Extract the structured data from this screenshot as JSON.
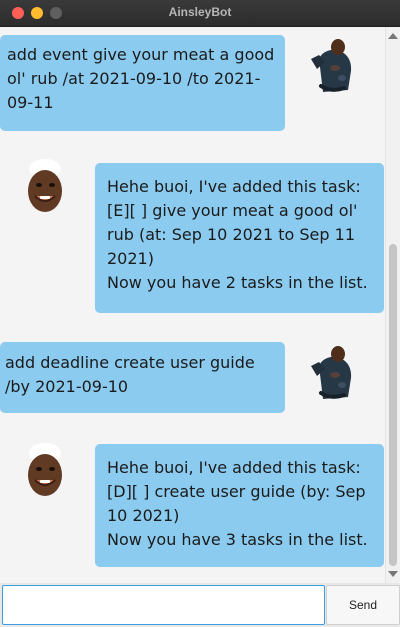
{
  "window": {
    "title": "AinsleyBot"
  },
  "messages": [
    {
      "sender": "user",
      "text": "add event give your meat a good ol' rub /at 2021-09-10 /to 2021-09-11"
    },
    {
      "sender": "bot",
      "lines": [
        "Hehe buoi, I've added this task:",
        "[E][ ] give your meat a good ol' rub (at: Sep 10 2021 to Sep 11 2021)",
        "Now you have 2 tasks in the list."
      ]
    },
    {
      "sender": "user",
      "text": "add deadline create user guide /by 2021-09-10"
    },
    {
      "sender": "bot",
      "lines": [
        "Hehe buoi, I've added this task:",
        "[D][ ] create user guide (by: Sep 10 2021)",
        "Now you have 3 tasks in the list."
      ]
    }
  ],
  "input": {
    "value": "",
    "placeholder": ""
  },
  "send_button": {
    "label": "Send"
  },
  "colors": {
    "bubble": "#8bcbef",
    "background": "#f4f4f4",
    "focus": "#3b9ddf"
  },
  "icons": {
    "user_avatar": "dancing-man-avatar",
    "bot_avatar": "smiling-chef-avatar"
  }
}
